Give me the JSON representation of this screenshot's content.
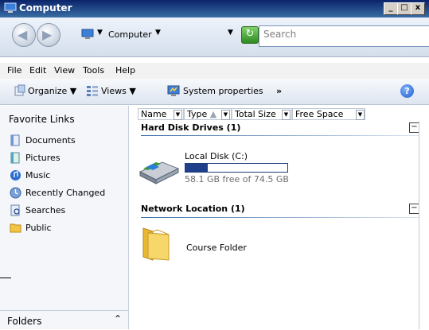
{
  "window": {
    "title": "Computer",
    "minimize": "_",
    "maximize": "□",
    "close": "x"
  },
  "address": {
    "location": "Computer",
    "search_placeholder": "Search"
  },
  "menu": [
    "File",
    "Edit",
    "View",
    "Tools",
    "Help"
  ],
  "toolbar": {
    "organize": "Organize",
    "views": "Views",
    "system_properties": "System properties",
    "more": "»"
  },
  "navigation": {
    "favorites_title": "Favorite Links",
    "favorites": [
      "Documents",
      "Pictures",
      "Music",
      "Recently Changed",
      "Searches",
      "Public"
    ],
    "folders_label": "Folders",
    "folders_caret": "⌃"
  },
  "columns": [
    "Name",
    "Type",
    "Total Size",
    "Free Space"
  ],
  "groups": {
    "hard_disk": "Hard Disk Drives (1)",
    "network": "Network Location (1)"
  },
  "drives": [
    {
      "name": "Local Disk (C:)",
      "free_text": "58.1 GB free of 74.5 GB",
      "used_fraction": 0.22
    }
  ],
  "network_items": [
    {
      "name": "Course Folder"
    }
  ],
  "colors": {
    "accent": "#1f3f8a",
    "titlebar": "#0a246a"
  }
}
